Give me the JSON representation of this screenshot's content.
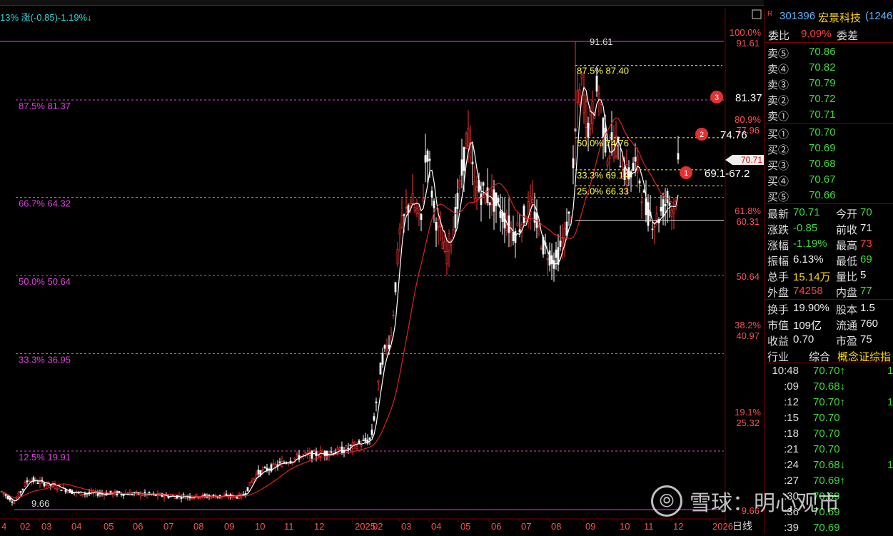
{
  "title_bar": "13% 涨(-0.85)-1.19%↓",
  "chart_data": {
    "type": "candlestick",
    "fib_levels_left": [
      {
        "label": "87.5% 81.37",
        "price": 81.37
      },
      {
        "label": "66.7% 64.32",
        "price": 64.32
      },
      {
        "label": "50.0% 50.64",
        "price": 50.64
      },
      {
        "label": "33.3% 36.95",
        "price": 36.95
      },
      {
        "label": "12.5% 19.91",
        "price": 19.91
      }
    ],
    "fib_levels_inner": [
      {
        "label": "87.5% 87.40",
        "price": 87.4
      },
      {
        "label": "50.0% 74.76",
        "price": 74.76
      },
      {
        "label": "33.3% 69.14",
        "price": 69.14
      },
      {
        "label": "25.0% 66.33",
        "price": 66.33
      }
    ],
    "axis_right": [
      {
        "pct": "100.0%",
        "price": "91.61"
      },
      {
        "pct": "80.9%",
        "price": "77.96"
      },
      {
        "pct": "61.8%",
        "price": "60.31"
      },
      {
        "pct": "",
        "price": "50.64"
      },
      {
        "pct": "38.2%",
        "price": "40.97"
      },
      {
        "pct": "19.1%",
        "price": "25.32"
      },
      {
        "pct": "",
        "price": "9.66"
      }
    ],
    "current_price_tag": "70.71",
    "high_label": "91.61",
    "low_label": "9.66",
    "markers": [
      {
        "num": "3",
        "text": "81.37"
      },
      {
        "num": "2",
        "text": "74.76"
      },
      {
        "num": "1",
        "text": "69.1-67.2"
      }
    ],
    "x_ticks": [
      "4",
      "02",
      "03",
      "04",
      "05",
      "06",
      "07",
      "08",
      "09",
      "10",
      "11",
      "12",
      "2025",
      "02",
      "03",
      "04",
      "05",
      "06",
      "07",
      "08",
      "09",
      "10",
      "11",
      "12",
      "2026"
    ],
    "period_label": "日线"
  },
  "stock": {
    "code": "301396",
    "name": "宏景科技",
    "extra": "(1246"
  },
  "ratio": {
    "label": "委比",
    "value": "9.09%",
    "diff_label": "委差"
  },
  "sells": [
    {
      "label": "卖⑤",
      "price": "70.86"
    },
    {
      "label": "卖④",
      "price": "70.82"
    },
    {
      "label": "卖③",
      "price": "70.79"
    },
    {
      "label": "卖②",
      "price": "70.72"
    },
    {
      "label": "卖①",
      "price": "70.71"
    }
  ],
  "buys": [
    {
      "label": "买①",
      "price": "70.70"
    },
    {
      "label": "买②",
      "price": "70.69"
    },
    {
      "label": "买③",
      "price": "70.68"
    },
    {
      "label": "买④",
      "price": "70.67"
    },
    {
      "label": "买⑤",
      "price": "70.66"
    }
  ],
  "quote": [
    {
      "l1": "最新",
      "v1": "70.71",
      "c1": "green",
      "l2": "今开",
      "v2": "70",
      "c2": "green"
    },
    {
      "l1": "涨跌",
      "v1": "-0.85",
      "c1": "green",
      "l2": "前收",
      "v2": "71",
      "c2": "white"
    },
    {
      "l1": "涨幅",
      "v1": "-1.19%",
      "c1": "green",
      "l2": "最高",
      "v2": "73",
      "c2": "red"
    },
    {
      "l1": "振幅",
      "v1": "6.13%",
      "c1": "white",
      "l2": "最低",
      "v2": "69",
      "c2": "green"
    },
    {
      "l1": "总手",
      "v1": "15.14万",
      "c1": "yellow",
      "l2": "量比",
      "v2": "5",
      "c2": "white"
    },
    {
      "l1": "外盘",
      "v1": "74258",
      "c1": "red",
      "l2": "内盘",
      "v2": "77",
      "c2": "green"
    }
  ],
  "fundamentals": [
    {
      "l1": "换手",
      "v1": "19.90%",
      "l2": "股本",
      "v2": "1.5"
    },
    {
      "l1": "市值",
      "v1": "109亿",
      "l2": "流通",
      "v2": "760"
    },
    {
      "l1": "收益",
      "v1": "0.70",
      "l2": "市盈",
      "v2": "75"
    }
  ],
  "industry": {
    "label": "行业",
    "value": "综合",
    "tag1": "概念",
    "tag2": "证综指"
  },
  "ticks": [
    {
      "time": "10:48",
      "price": "70.70↑",
      "pc": "green",
      "vol": "1"
    },
    {
      "time": ":09",
      "price": "70.68↓",
      "pc": "green",
      "vol": ""
    },
    {
      "time": ":12",
      "price": "70.70↑",
      "pc": "green",
      "vol": "1"
    },
    {
      "time": ":15",
      "price": "70.70",
      "pc": "green",
      "vol": ""
    },
    {
      "time": ":18",
      "price": "70.70",
      "pc": "green",
      "vol": ""
    },
    {
      "time": ":21",
      "price": "70.70",
      "pc": "green",
      "vol": ""
    },
    {
      "time": ":24",
      "price": "70.68↓",
      "pc": "green",
      "vol": "1"
    },
    {
      "time": ":27",
      "price": "70.69↑",
      "pc": "green",
      "vol": ""
    },
    {
      "time": ":30",
      "price": "70.69",
      "pc": "green",
      "vol": ""
    },
    {
      "time": ":36",
      "price": "70.69",
      "pc": "green",
      "vol": ""
    },
    {
      "time": ":39",
      "price": "70.69",
      "pc": "green",
      "vol": ""
    }
  ],
  "watermark": "雪球：明心观市",
  "colors": {
    "up": "#ff3030",
    "down": "#3cdc3c",
    "fib": "#e040e0",
    "inner": "#ffff40",
    "ma_white": "#ffffff",
    "ma_red": "#e02020",
    "frame": "#7a0000"
  }
}
